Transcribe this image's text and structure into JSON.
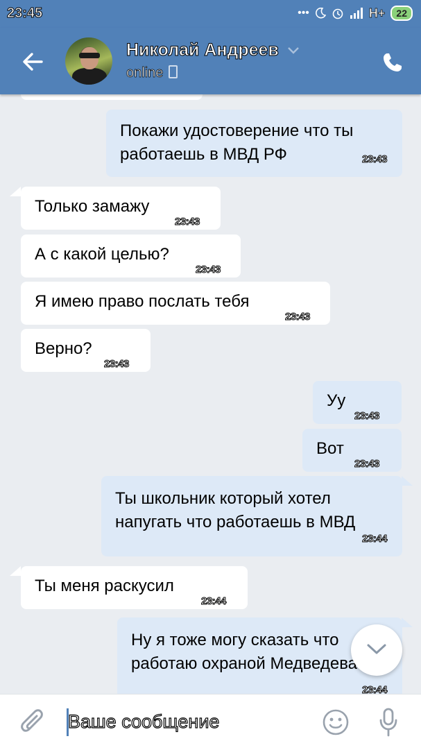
{
  "status_bar": {
    "time": "23:45",
    "icons": [
      "more-dots-icon",
      "moon-icon",
      "alarm-icon",
      "signal-icon"
    ],
    "network": "H+",
    "battery": "22"
  },
  "header": {
    "contact_name": "Николай Андреев",
    "status": "online",
    "accent": "#5181b8"
  },
  "messages": [
    {
      "dir": "out",
      "text": "Покажи удостоверение что ты\nработаешь в МВД РФ",
      "time": "23:43"
    },
    {
      "dir": "in",
      "text": "Только замажу",
      "time": "23:43"
    },
    {
      "dir": "in",
      "text": "А с какой целью?",
      "time": "23:43"
    },
    {
      "dir": "in",
      "text": "Я имею право послать тебя",
      "time": "23:43"
    },
    {
      "dir": "in",
      "text": "Верно?",
      "time": "23:43"
    },
    {
      "dir": "out",
      "text": "Уу",
      "time": "23:43"
    },
    {
      "dir": "out",
      "text": "Вот",
      "time": "23:43"
    },
    {
      "dir": "out",
      "text": "Ты школьник который хотел\nнапугать что работаешь в МВД",
      "time": "23:44"
    },
    {
      "dir": "in",
      "text": "Ты меня раскусил",
      "time": "23:44"
    },
    {
      "dir": "out",
      "text": "Ну я тоже могу сказать что\nработаю охраной Медведева",
      "time": "23:44"
    }
  ],
  "composer": {
    "placeholder": "Ваше сообщение"
  },
  "colors": {
    "incoming_bubble": "#ffffff",
    "outgoing_bubble": "#dde9f7",
    "chat_background": "#eaedf1"
  }
}
